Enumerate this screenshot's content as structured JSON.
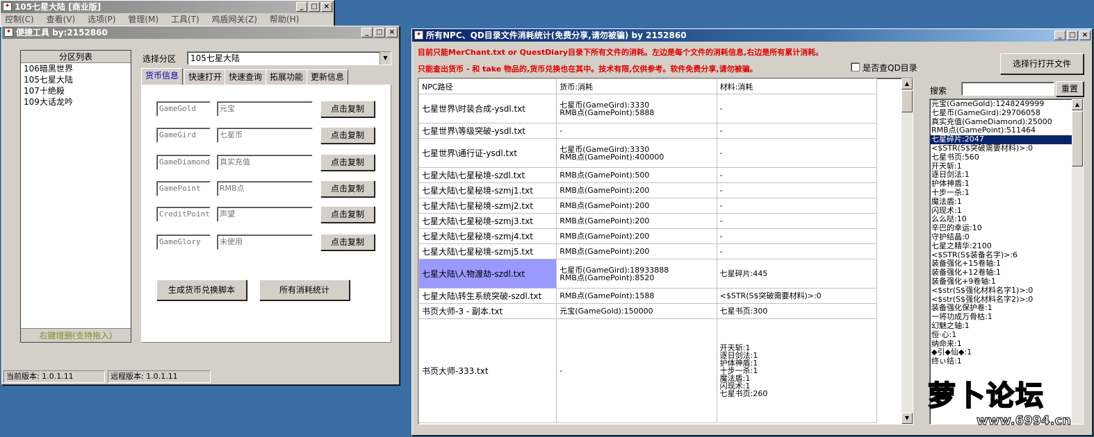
{
  "colors": {
    "accent": "#0a246a",
    "red_text": "#e00000",
    "highlight": "#9999ff",
    "selection": "#0a246a",
    "olive": "#8a8a2a"
  },
  "main_window": {
    "title": "105七星大陆 [商业版]",
    "menu": [
      "控制(C)",
      "查看(V)",
      "选项(P)",
      "管理(M)",
      "工具(T)",
      "鸡盾网关(Z)",
      "帮助(H)"
    ]
  },
  "tools_window": {
    "title": "便捷工具  by:2152860",
    "region_list_header": "分区列表",
    "regions": [
      "106暗黑世界",
      "105七星大陆",
      "107十绝殺",
      "109大话龙吟"
    ],
    "region_footer": "右键增删(支持拖入)",
    "select_label": "选择分区",
    "select_value": "105七星大陆",
    "tabs": [
      "货币信息",
      "快速打开",
      "快速查询",
      "拓展功能",
      "更新信息"
    ],
    "currency_rows": [
      {
        "code": "GameGold",
        "name": "元宝",
        "button": "点击复制"
      },
      {
        "code": "GameGird",
        "name": "七星币",
        "button": "点击复制"
      },
      {
        "code": "GameDiamond",
        "name": "真实充值",
        "button": "点击复制"
      },
      {
        "code": "GamePoint",
        "name": "RMB点",
        "button": "点击复制"
      },
      {
        "code": "CreditPoint",
        "name": "声望",
        "button": "点击复制"
      },
      {
        "code": "GameGlory",
        "name": "未使用",
        "button": "点击复制"
      }
    ],
    "gen_button": "生成货币兑换脚本",
    "stats_button": "所有消耗统计",
    "current_version": "当前版本: 1.0.1.11",
    "remote_version": "远程版本: 1.0.1.11"
  },
  "stats_window": {
    "title": "所有NPC、QD目录文件消耗统计(免费分享,请勿被骗)     by 2152860",
    "notice1": "目前只能MerChant.txt or QuestDiary目录下所有文件的消耗。左边是每个文件的消耗信息,右边是所有累计消耗。",
    "notice2": "只能查出货币 - 和 take 物品的,货币兑换也在其中。技术有限,仅供参考。软件免费分享,请勿被骗。",
    "checkbox_label": "是否查QD目录",
    "open_button": "选择行打开文件",
    "search_label": "搜索",
    "search_value": "",
    "reset_button": "重置",
    "columns": [
      "NPC路径",
      "货币:消耗",
      "材料:消耗"
    ],
    "rows": [
      {
        "path": "七星世界\\时装合成-ysdl.txt",
        "currency": [
          "七星币(GameGird):3330",
          "RMB点(GamePoint):5888"
        ],
        "material": [
          "-"
        ]
      },
      {
        "path": "七星世界\\等级突破-ysdl.txt",
        "currency": [
          "-"
        ],
        "material": [
          "-"
        ]
      },
      {
        "path": "七星世界\\通行证-ysdl.txt",
        "currency": [
          "七星币(GameGird):3330",
          "RMB点(GamePoint):400000"
        ],
        "material": [
          "-"
        ]
      },
      {
        "path": "七星大陆\\七星秘境-szdl.txt",
        "currency": [
          "RMB点(GamePoint):500"
        ],
        "material": [
          "-"
        ]
      },
      {
        "path": "七星大陆\\七星秘境-szmj1.txt",
        "currency": [
          "RMB点(GamePoint):200"
        ],
        "material": [
          "-"
        ]
      },
      {
        "path": "七星大陆\\七星秘境-szmj2.txt",
        "currency": [
          "RMB点(GamePoint):200"
        ],
        "material": [
          "-"
        ]
      },
      {
        "path": "七星大陆\\七星秘境-szmj3.txt",
        "currency": [
          "RMB点(GamePoint):200"
        ],
        "material": [
          "-"
        ]
      },
      {
        "path": "七星大陆\\七星秘境-szmj4.txt",
        "currency": [
          "RMB点(GamePoint):200"
        ],
        "material": [
          "-"
        ]
      },
      {
        "path": "七星大陆\\七星秘境-szmj5.txt",
        "currency": [
          "RMB点(GamePoint):200"
        ],
        "material": [
          "-"
        ]
      },
      {
        "path": "七星大陆\\人物渡劫-szdl.txt",
        "currency": [
          "七星币(GameGird):18933888",
          "RMB点(GamePoint):8520"
        ],
        "material": [
          "七星碎片:445"
        ]
      },
      {
        "path": "七星大陆\\转生系统突破-szdl.txt",
        "currency": [
          "RMB点(GamePoint):1588"
        ],
        "material": [
          "<$STR(S$突破需要材料)>:0"
        ]
      },
      {
        "path": "书页大师-3 - 副本.txt",
        "currency": [
          "元宝(GameGold):150000"
        ],
        "material": [
          "七星书页:300"
        ]
      },
      {
        "path": "书页大师-333.txt",
        "currency": [
          "-"
        ],
        "material": [
          "开天斩:1",
          "逐日剑法:1",
          "护体神盾:1",
          "十步一杀:1",
          "魔法盾:1",
          "闪现术:1",
          "七星书页:260"
        ]
      }
    ],
    "totals": [
      "元宝(GameGold):1248249999",
      "七星币(GameGird):29706058",
      "真实充值(GameDiamond):25000",
      "RMB点(GamePoint):511464",
      "七星碎片:2047",
      "<$STR(S$突破需要材料)>:0",
      "七星书页:560",
      "开天斩:1",
      "逐日剑法:1",
      "护体神盾:1",
      "十步一杀:1",
      "魔法盾:1",
      "闪现术:1",
      "么么哒:10",
      "辛巴的幸运:10",
      "守护结晶:0",
      "七星之精华:2100",
      "<$STR(S$装备名字)>:6",
      "装备强化+15卷轴:1",
      "装备强化+12卷轴:1",
      "装备强化+9卷轴:1",
      "<$str(S$强化材料名字1)>:0",
      "<$str(S$强化材料名字2)>:0",
      "装备强化保护卷:1",
      "一将功成万骨枯:1",
      "幻魅之轴:1",
      "恒·心:1",
      "纳命来:1",
      "◆引◆仙◆:1",
      "终ぃ结:1"
    ],
    "selected_total_index": 4
  },
  "watermark": {
    "text": "萝卜论坛",
    "url": "www.6994.cn"
  }
}
